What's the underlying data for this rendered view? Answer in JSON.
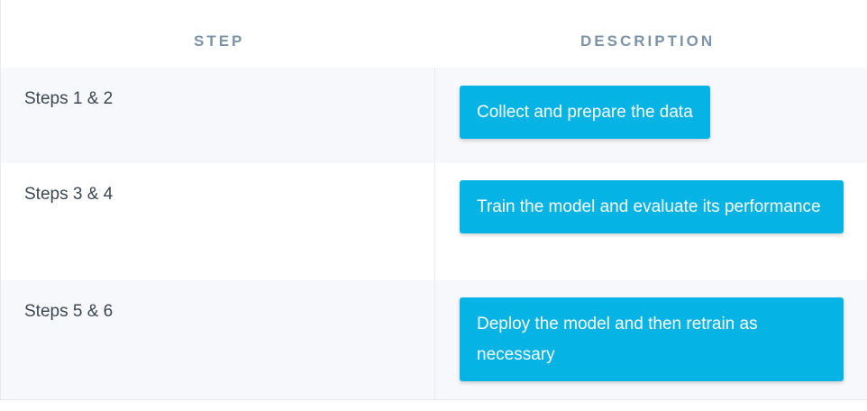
{
  "table": {
    "headers": {
      "step": "STEP",
      "description": "DESCRIPTION"
    },
    "rows": [
      {
        "step": "Steps 1 & 2",
        "description": "Collect and prepare the data"
      },
      {
        "step": "Steps 3 & 4",
        "description": "Train the model and evaluate its performance"
      },
      {
        "step": "Steps 5 & 6",
        "description": "Deploy the model and then retrain as necessary"
      }
    ]
  },
  "colors": {
    "header_text": "#7d93a8",
    "row_alt_bg": "#f7f8fb",
    "description_box_bg": "#05b3e4",
    "description_text": "#ffffff",
    "step_text": "#3c4651",
    "border": "#e6e9ee"
  }
}
